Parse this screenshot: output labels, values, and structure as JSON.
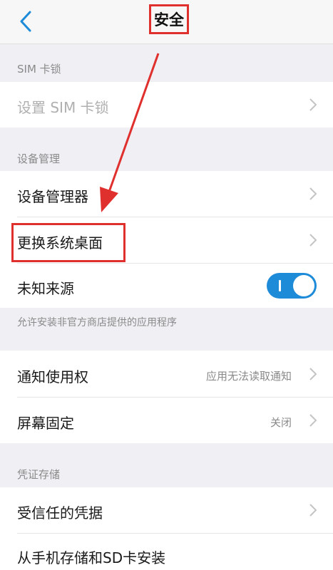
{
  "header": {
    "title": "安全"
  },
  "sections": {
    "sim_lock": {
      "header": "SIM 卡锁",
      "items": [
        {
          "label": "设置 SIM 卡锁"
        }
      ]
    },
    "device_admin": {
      "header": "设备管理",
      "items": [
        {
          "label": "设备管理器"
        },
        {
          "label": "更换系统桌面"
        },
        {
          "label": "未知来源",
          "toggle": true,
          "description": "允许安装非官方商店提供的应用程序"
        }
      ]
    },
    "notifications": {
      "items": [
        {
          "label": "通知使用权",
          "value": "应用无法读取通知"
        },
        {
          "label": "屏幕固定",
          "value": "关闭"
        }
      ]
    },
    "credentials": {
      "header": "凭证存储",
      "items": [
        {
          "label": "受信任的凭据"
        },
        {
          "label": "从手机存储和SD卡安装"
        }
      ]
    }
  },
  "colors": {
    "accent": "#1e8bd8",
    "annotation_red": "#e0302e",
    "background": "#efeff4"
  },
  "icons": {
    "back": "chevron-left-icon",
    "row_arrow": "chevron-right-icon"
  }
}
